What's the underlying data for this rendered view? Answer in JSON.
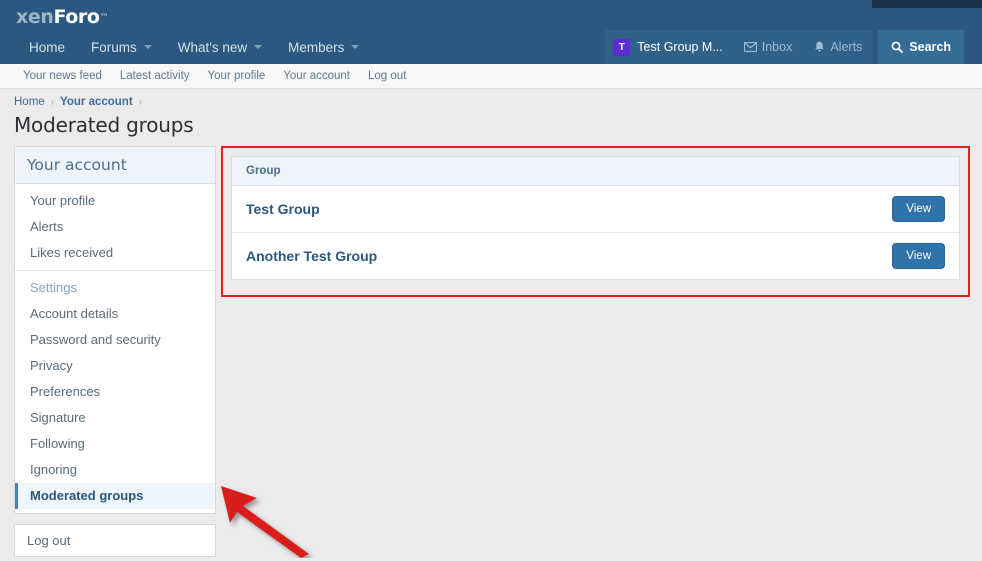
{
  "header": {
    "logo_xen": "xen",
    "logo_foro": "Foro",
    "logo_tm": "™",
    "nav_items": [
      {
        "label": "Home",
        "has_caret": false
      },
      {
        "label": "Forums",
        "has_caret": true
      },
      {
        "label": "What's new",
        "has_caret": true
      },
      {
        "label": "Members",
        "has_caret": true
      }
    ],
    "account": {
      "avatar_letter": "T",
      "name": "Test Group M..."
    },
    "inbox_label": "Inbox",
    "alerts_label": "Alerts",
    "search_label": "Search"
  },
  "sub_nav": {
    "items": [
      "Your news feed",
      "Latest activity",
      "Your profile",
      "Your account",
      "Log out"
    ]
  },
  "breadcrumb": {
    "home": "Home",
    "sep1": "›",
    "account": "Your account",
    "sep2": "›"
  },
  "page": {
    "title": "Moderated groups"
  },
  "sidebar": {
    "header": "Your account",
    "group1": [
      {
        "label": "Your profile",
        "active": false
      },
      {
        "label": "Alerts",
        "active": false
      },
      {
        "label": "Likes received",
        "active": false
      }
    ],
    "section_label": "Settings",
    "group2": [
      {
        "label": "Account details",
        "active": false
      },
      {
        "label": "Password and security",
        "active": false
      },
      {
        "label": "Privacy",
        "active": false
      },
      {
        "label": "Preferences",
        "active": false
      },
      {
        "label": "Signature",
        "active": false
      },
      {
        "label": "Following",
        "active": false
      },
      {
        "label": "Ignoring",
        "active": false
      },
      {
        "label": "Moderated groups",
        "active": true
      }
    ],
    "logout": "Log out"
  },
  "main": {
    "column_header": "Group",
    "rows": [
      {
        "name": "Test Group",
        "action": "View"
      },
      {
        "name": "Another Test Group",
        "action": "View"
      }
    ]
  },
  "annotations": {
    "highlight_color": "#e02222",
    "arrow_color": "#d91f1f"
  },
  "colors": {
    "header_bg": "#2b5880",
    "page_bg": "#ebebeb",
    "accent_blue": "#3073ab",
    "panel_header_bg": "#eef4fa",
    "avatar_bg": "#5c2ed1"
  }
}
